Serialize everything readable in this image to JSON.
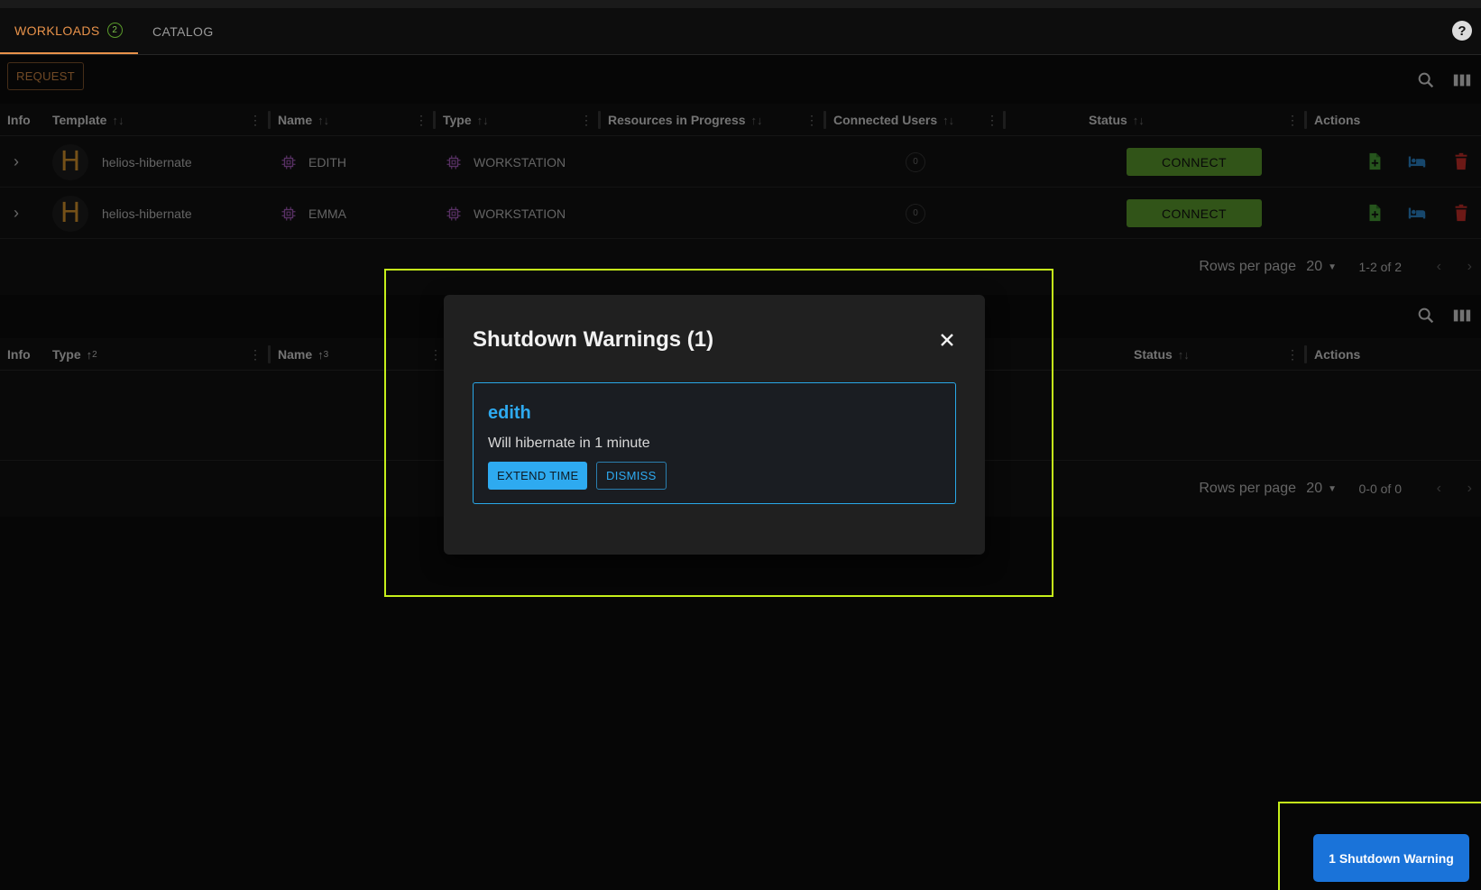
{
  "tabs": {
    "workloads_label": "WORKLOADS",
    "workloads_badge": "2",
    "catalog_label": "CATALOG"
  },
  "toolbar": {
    "request_label": "REQUEST"
  },
  "workloads_table": {
    "headers": {
      "info": "Info",
      "template": "Template",
      "name": "Name",
      "type": "Type",
      "resources": "Resources in Progress",
      "users": "Connected Users",
      "status": "Status",
      "actions": "Actions"
    },
    "rows": [
      {
        "avatar": "H",
        "template": "helios-hibernate",
        "name": "EDITH",
        "type": "WORKSTATION",
        "users": "0",
        "status_button": "CONNECT"
      },
      {
        "avatar": "H",
        "template": "helios-hibernate",
        "name": "EMMA",
        "type": "WORKSTATION",
        "users": "0",
        "status_button": "CONNECT"
      }
    ],
    "pager": {
      "rows_per_page_label": "Rows per page",
      "rows_per_page": "20",
      "range": "1-2 of 2"
    }
  },
  "second_table": {
    "headers": {
      "info": "Info",
      "type": "Type",
      "type_sort_index": "2",
      "name": "Name",
      "name_sort_index": "3",
      "status": "Status",
      "actions": "Actions"
    },
    "pager": {
      "rows_per_page_label": "Rows per page",
      "rows_per_page": "20",
      "range": "0-0 of 0"
    }
  },
  "modal": {
    "title": "Shutdown Warnings (1)",
    "warning": {
      "name": "edith",
      "message": "Will hibernate in 1 minute",
      "extend_label": "EXTEND TIME",
      "dismiss_label": "DISMISS"
    }
  },
  "toast": {
    "label": "1 Shutdown Warning"
  },
  "colors": {
    "accent_orange": "#e8924a",
    "connect_green": "#63a830",
    "info_blue": "#2eaaf0",
    "highlight": "#c6ef1a",
    "toast_blue": "#1a73d9"
  },
  "icons": [
    "help-icon",
    "search-icon",
    "columns-icon",
    "chevron-right-icon",
    "cpu-icon",
    "add-file-icon",
    "hibernate-bed-icon",
    "delete-icon",
    "close-icon",
    "caret-down-icon"
  ]
}
